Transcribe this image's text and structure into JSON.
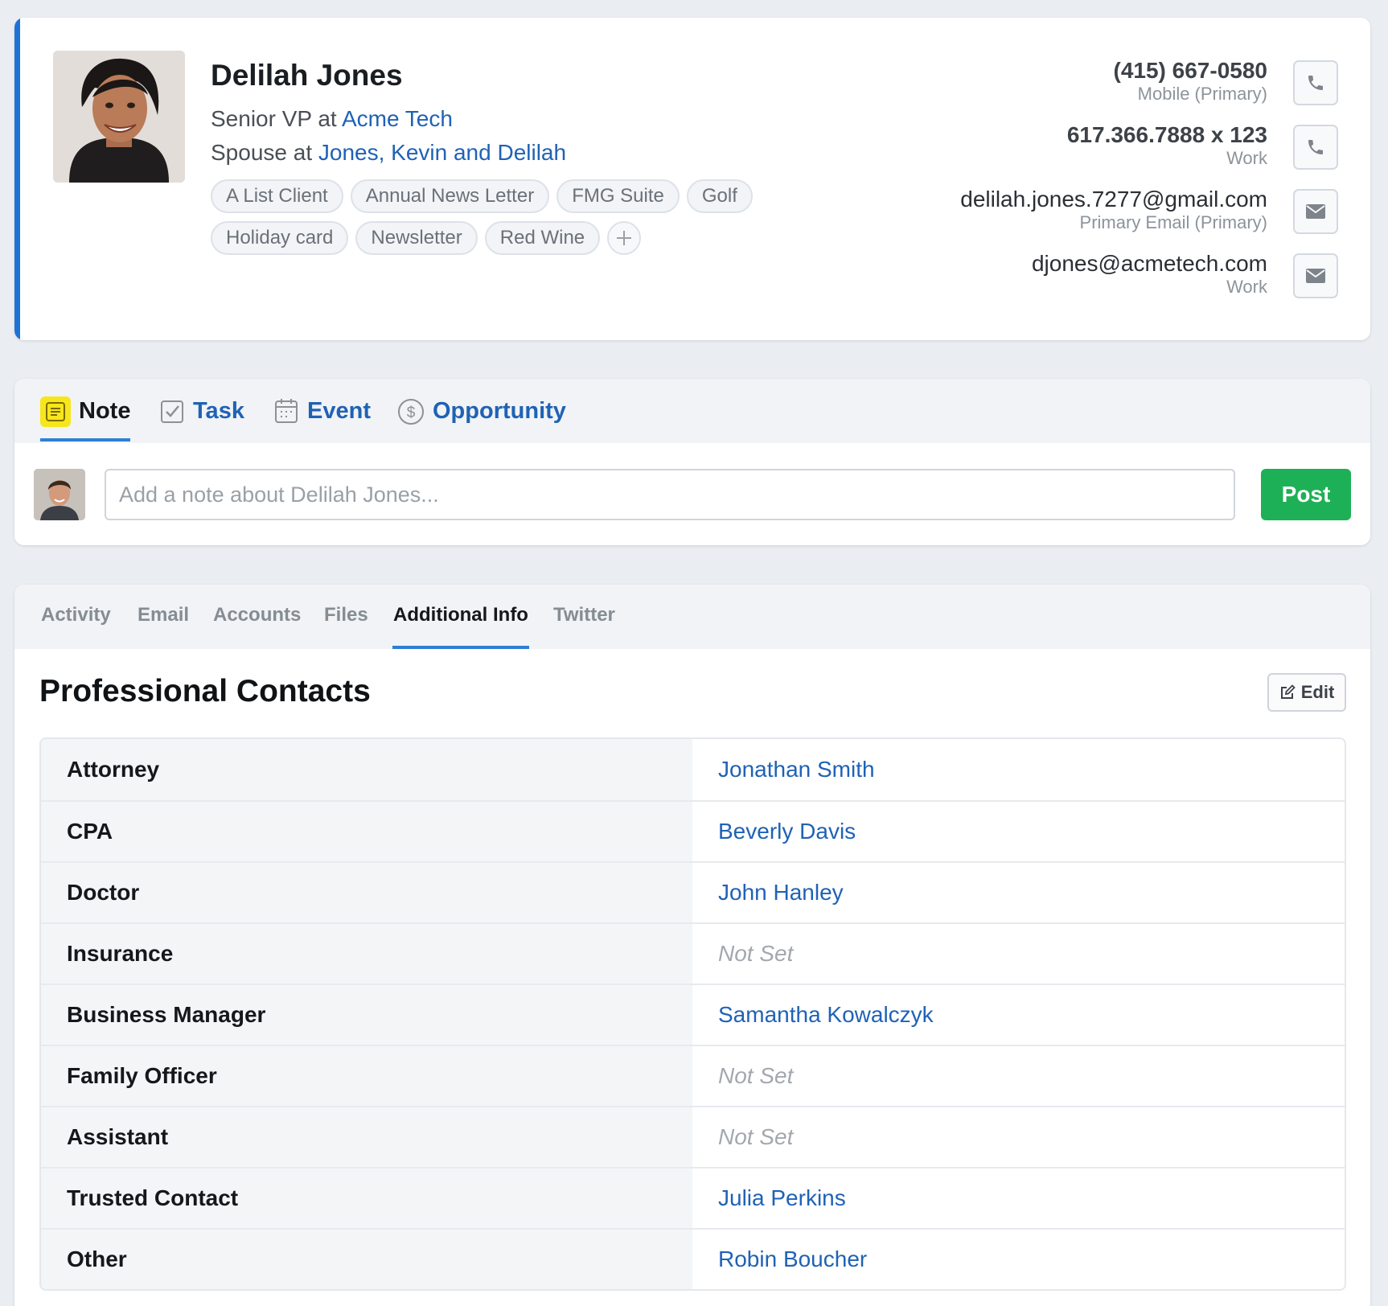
{
  "contact": {
    "name": "Delilah Jones",
    "role_prefix": "Senior VP at ",
    "company": "Acme Tech",
    "relation_prefix": "Spouse at ",
    "household": "Jones, Kevin and Delilah",
    "tags": [
      "A List Client",
      "Annual News Letter",
      "FMG Suite",
      "Golf",
      "Holiday card",
      "Newsletter",
      "Red Wine"
    ],
    "info": [
      {
        "value": "(415) 667-0580",
        "sub": "Mobile (Primary)",
        "icon": "phone-icon"
      },
      {
        "value": "617.366.7888 x 123",
        "sub": "Work",
        "icon": "phone-icon"
      },
      {
        "value": "delilah.jones.7277@gmail.com",
        "sub": "Primary Email (Primary)",
        "icon": "mail-icon"
      },
      {
        "value": "djones@acmetech.com",
        "sub": "Work",
        "icon": "mail-icon"
      }
    ]
  },
  "composer": {
    "tabs": [
      "Note",
      "Task",
      "Event",
      "Opportunity"
    ],
    "active_tab": "Note",
    "placeholder": "Add a note about Delilah Jones...",
    "post_label": "Post"
  },
  "details": {
    "tabs": [
      "Activity",
      "Email",
      "Accounts",
      "Files",
      "Additional Info",
      "Twitter"
    ],
    "active_tab": "Additional Info",
    "section_title": "Professional Contacts",
    "edit_label": "Edit",
    "rows": [
      {
        "label": "Attorney",
        "value": "Jonathan Smith",
        "set": true
      },
      {
        "label": "CPA",
        "value": "Beverly Davis",
        "set": true
      },
      {
        "label": "Doctor",
        "value": "John Hanley",
        "set": true
      },
      {
        "label": "Insurance",
        "value": "Not Set",
        "set": false
      },
      {
        "label": "Business Manager",
        "value": "Samantha Kowalczyk",
        "set": true
      },
      {
        "label": "Family Officer",
        "value": "Not Set",
        "set": false
      },
      {
        "label": "Assistant",
        "value": "Not Set",
        "set": false
      },
      {
        "label": "Trusted Contact",
        "value": "Julia Perkins",
        "set": true
      },
      {
        "label": "Other",
        "value": "Robin Boucher",
        "set": true
      }
    ]
  },
  "colors": {
    "accent": "#1f72d6",
    "link": "#1f62b5",
    "post_button": "#1eb056",
    "note_icon": "#f7e61c"
  }
}
